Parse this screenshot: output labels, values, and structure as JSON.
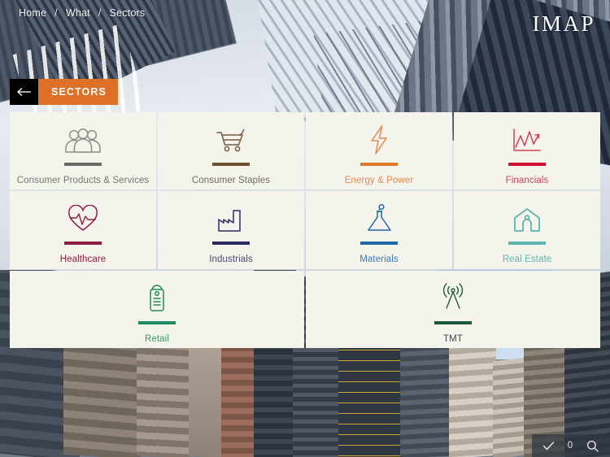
{
  "breadcrumb": {
    "items": [
      "Home",
      "What",
      "Sectors"
    ],
    "separator": "/"
  },
  "logo": {
    "text": "IMAP"
  },
  "section_bar": {
    "back_icon": "arrow-left-icon",
    "title": "SECTORS",
    "accent_color": "#de7127",
    "back_bg": "#000000"
  },
  "panel": {
    "background": "#f4f3ec",
    "rows": [
      {
        "tiles": [
          {
            "label": "Consumer Products & Services",
            "icon": "people-group-icon",
            "color": "#8d8d88"
          },
          {
            "label": "Consumer Staples",
            "icon": "shopping-cart-icon",
            "color": "#7a5a3c"
          },
          {
            "label": "Energy & Power",
            "icon": "lightning-bolt-icon",
            "color": "#e08a4e"
          },
          {
            "label": "Financials",
            "icon": "line-chart-icon",
            "color": "#cf2b45"
          }
        ]
      },
      {
        "tiles": [
          {
            "label": "Healthcare",
            "icon": "heart-pulse-icon",
            "color": "#8e1d45"
          },
          {
            "label": "Industrials",
            "icon": "factory-icon",
            "color": "#2b2b63"
          },
          {
            "label": "Materials",
            "icon": "flask-icon",
            "color": "#1f6aa8"
          },
          {
            "label": "Real Estate",
            "icon": "house-icon",
            "color": "#5cb5ae"
          }
        ]
      },
      {
        "tiles": [
          {
            "label": "Retail",
            "icon": "price-tag-icon",
            "color": "#1f8a5f"
          },
          {
            "label": "TMT",
            "icon": "broadcast-tower-icon",
            "color": "#20583f"
          }
        ]
      }
    ]
  },
  "toolbar": {
    "check_icon": "check-icon",
    "count": "0",
    "search_icon": "search-icon"
  }
}
